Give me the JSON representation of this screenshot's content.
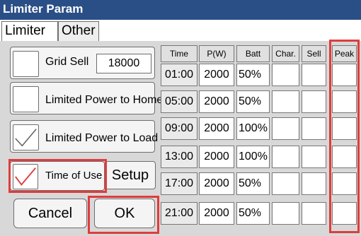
{
  "window": {
    "title": "Limiter Param"
  },
  "tabs": [
    {
      "label": "Limiter"
    },
    {
      "label": "Other"
    }
  ],
  "left_panel": {
    "grid_sell": {
      "label": "Grid Sell",
      "value": "18000"
    },
    "limited_power_to_home": {
      "label": "Limited Power to Home"
    },
    "limited_power_to_load": {
      "label": "Limited Power to Load"
    },
    "time_of_use": {
      "label": "Time of Use"
    },
    "setup_button": "Setup"
  },
  "table": {
    "headers": [
      "Time",
      "P(W)",
      "Batt",
      "Char.",
      "Sell",
      "Peak"
    ],
    "rows": [
      {
        "time": "01:00",
        "power": "2000",
        "batt": "50%"
      },
      {
        "time": "05:00",
        "power": "2000",
        "batt": "50%"
      },
      {
        "time": "09:00",
        "power": "2000",
        "batt": "100%"
      },
      {
        "time": "13:00",
        "power": "2000",
        "batt": "100%"
      },
      {
        "time": "17:00",
        "power": "2000",
        "batt": "50%"
      },
      {
        "time": "21:00",
        "power": "2000",
        "batt": "50%"
      }
    ]
  },
  "footer": {
    "cancel": "Cancel",
    "ok": "OK"
  },
  "colors": {
    "titlebar": "#2a4f86",
    "highlight": "#e03c3c",
    "panel": "#d8d8d8"
  }
}
